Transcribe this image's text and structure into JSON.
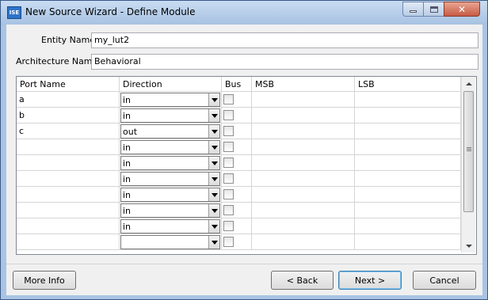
{
  "window": {
    "title": "New Source Wizard - Define Module",
    "app_icon_text": "ISE"
  },
  "form": {
    "entity_label": "Entity Name",
    "entity_value": "my_lut2",
    "architecture_label": "Architecture Name",
    "architecture_value": "Behavioral"
  },
  "table": {
    "columns": [
      "Port Name",
      "Direction",
      "Bus",
      "MSB",
      "LSB"
    ],
    "rows": [
      {
        "port": "a",
        "direction": "in",
        "bus": false,
        "msb": "",
        "lsb": ""
      },
      {
        "port": "b",
        "direction": "in",
        "bus": false,
        "msb": "",
        "lsb": ""
      },
      {
        "port": "c",
        "direction": "out",
        "bus": false,
        "msb": "",
        "lsb": ""
      },
      {
        "port": "",
        "direction": "in",
        "bus": false,
        "msb": "",
        "lsb": ""
      },
      {
        "port": "",
        "direction": "in",
        "bus": false,
        "msb": "",
        "lsb": ""
      },
      {
        "port": "",
        "direction": "in",
        "bus": false,
        "msb": "",
        "lsb": ""
      },
      {
        "port": "",
        "direction": "in",
        "bus": false,
        "msb": "",
        "lsb": ""
      },
      {
        "port": "",
        "direction": "in",
        "bus": false,
        "msb": "",
        "lsb": ""
      },
      {
        "port": "",
        "direction": "in",
        "bus": false,
        "msb": "",
        "lsb": ""
      },
      {
        "port": "",
        "direction": "",
        "bus": false,
        "msb": "",
        "lsb": ""
      }
    ]
  },
  "buttons": {
    "more_info": "More Info",
    "back": "< Back",
    "next": "Next >",
    "cancel": "Cancel"
  }
}
